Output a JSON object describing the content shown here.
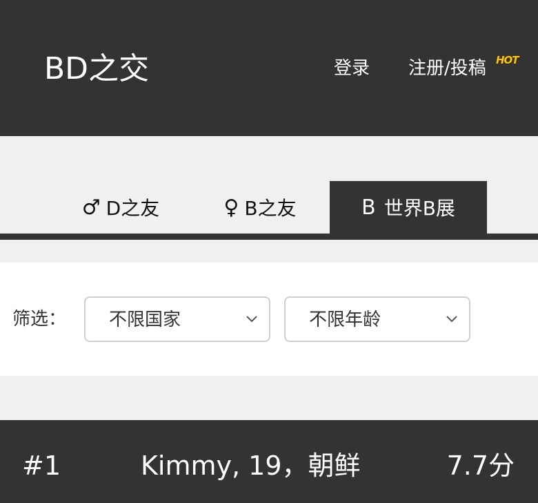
{
  "header": {
    "brand": "BD之交",
    "login_label": "登录",
    "register_label": "注册/投稿",
    "hot_badge": "HOT"
  },
  "tabs": [
    {
      "icon": "♂",
      "icon_name": "male-symbol-icon",
      "label": "D之友",
      "active": false
    },
    {
      "icon": "♀",
      "icon_name": "female-symbol-icon",
      "label": "B之友",
      "active": false
    },
    {
      "icon": "B",
      "icon_name": "b-letter-icon",
      "label": "世界B展",
      "active": true
    }
  ],
  "filter": {
    "label": "筛选：",
    "country_value": "不限国家",
    "age_value": "不限年龄"
  },
  "results": [
    {
      "rank": "#1",
      "person": "Kimmy, 19，朝鲜",
      "score": "7.7分"
    }
  ],
  "colors": {
    "dark": "#333333",
    "light_bg": "#f0f0f0",
    "panel": "#ffffff",
    "hot_badge": "#f5c518"
  }
}
